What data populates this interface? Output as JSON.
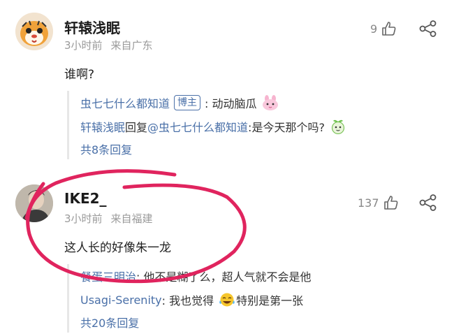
{
  "comments": [
    {
      "user": "轩辕浅眠",
      "time": "3小时前",
      "location": "来自广东",
      "likes": "9",
      "text": "谁啊?",
      "avatar_icon": "tiger-avatar",
      "replies": [
        {
          "name": "虫七七什么都知道",
          "badge": "博主",
          "text": ": 动动脑瓜",
          "emoji": "pink-bunny-emoji"
        },
        {
          "name": "轩辕浅眠",
          "reply_word": " 回复",
          "at_name": "@虫七七什么都知道",
          "text": ":是今天那个吗?",
          "emoji": "green-leaf-emoji"
        }
      ],
      "more": "共8条回复"
    },
    {
      "user": "IKE2_",
      "time": "3小时前",
      "location": "来自福建",
      "likes": "137",
      "text": "这人长的好像朱一龙",
      "avatar_icon": "photo-avatar",
      "replies": [
        {
          "name": "餐蛋三明治",
          "text": ": 他不是糊了么，超人气就不会是他"
        },
        {
          "name": "Usagi-Serenity",
          "text": ": 我也觉得",
          "emoji": "laughing-tears-emoji",
          "text2": "特别是第一张"
        }
      ],
      "more": "共20条回复"
    }
  ],
  "annotation_color": "#e0245e"
}
